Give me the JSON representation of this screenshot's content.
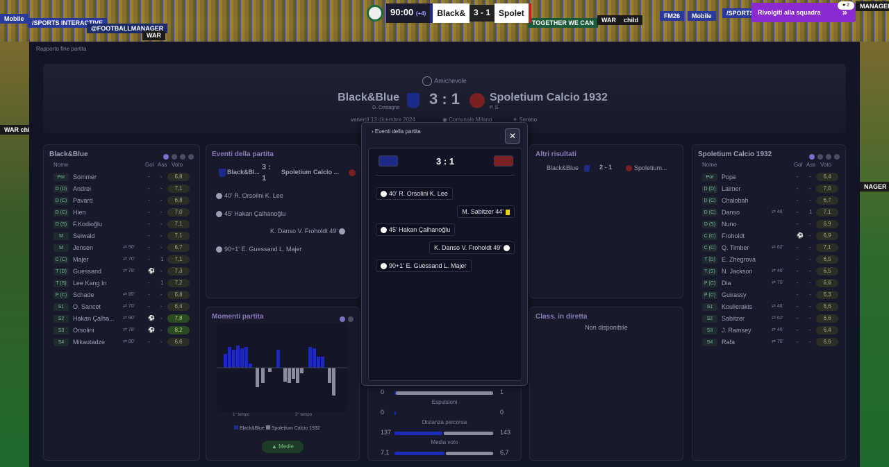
{
  "breadcrumb": "Rapporto fine partita",
  "topbar": {
    "clock": "90:00",
    "added": "(+4)",
    "home": "Black&",
    "score": "3 - 1",
    "away": "Spolet",
    "back_button": "Rivolgiti alla squadra",
    "notif_count": "2"
  },
  "ads": [
    "Mobile",
    "/SPORTS INTERACTIVE",
    "@FOOTBALLMANAGER",
    "WAR",
    "TOGETHER WE CAN",
    "WAR",
    "child",
    "FM26",
    "Mobile",
    "/SPORTS",
    "MANAGER",
    "WAR chi",
    "NAGER"
  ],
  "hero": {
    "competition": "Amichevole",
    "home": "Black&Blue",
    "home_manager": "D. Costagna",
    "score": "3 : 1",
    "away": "Spoletium Calcio 1932",
    "away_manager": "P. S",
    "date": "venerdì 13 dicembre 2024",
    "stadium": "Comunale Milano",
    "weather": "Sereno"
  },
  "home_panel": {
    "title": "Black&Blue",
    "headers": {
      "name": "Nome",
      "gol": "Gol",
      "ass": "Ass",
      "voto": "Voto"
    },
    "rows": [
      {
        "pos": "Por",
        "name": "Sommer",
        "sub": "",
        "gol": "-",
        "ass": "-",
        "voto": "6,8"
      },
      {
        "pos": "D (D)",
        "name": "Andrei",
        "sub": "",
        "gol": "-",
        "ass": "-",
        "voto": "7,1"
      },
      {
        "pos": "D (C)",
        "name": "Pavard",
        "sub": "",
        "gol": "-",
        "ass": "-",
        "voto": "6,8"
      },
      {
        "pos": "D (C)",
        "name": "Hien",
        "sub": "",
        "gol": "-",
        "ass": "-",
        "voto": "7,0"
      },
      {
        "pos": "D (S)",
        "name": "F.Kodioğlu",
        "sub": "",
        "gol": "-",
        "ass": "-",
        "voto": "7,1"
      },
      {
        "pos": "M",
        "name": "Seiwald",
        "sub": "",
        "gol": "-",
        "ass": "-",
        "voto": "7,1"
      },
      {
        "pos": "M",
        "name": "Jensen",
        "sub": "90'",
        "gol": "-",
        "ass": "-",
        "voto": "6,7"
      },
      {
        "pos": "C (C)",
        "name": "Majer",
        "sub": "70'",
        "gol": "-",
        "ass": "1",
        "voto": "7,1"
      },
      {
        "pos": "T (D)",
        "name": "Guessand",
        "sub": "78'",
        "gol": "",
        "ass": "-",
        "voto": "7,3"
      },
      {
        "pos": "T (S)",
        "name": "Lee Kang In",
        "sub": "",
        "gol": "-",
        "ass": "1",
        "voto": "7,2"
      },
      {
        "pos": "P (C)",
        "name": "Schade",
        "sub": "80'",
        "gol": "-",
        "ass": "-",
        "voto": "6,8"
      },
      {
        "pos": "S1",
        "name": "O. Sancet",
        "sub": "70'",
        "gol": "-",
        "ass": "-",
        "voto": "6,4"
      },
      {
        "pos": "S2",
        "name": "Hakan Çalha...",
        "sub": "90'",
        "gol": "",
        "ass": "-",
        "voto": "7,8"
      },
      {
        "pos": "S3",
        "name": "Orsolini",
        "sub": "78'",
        "gol": "",
        "ass": "-",
        "voto": "8,2"
      },
      {
        "pos": "S4",
        "name": "Mikautadze",
        "sub": "80'",
        "gol": "-",
        "ass": "-",
        "voto": "6,6"
      }
    ]
  },
  "away_panel": {
    "title": "Spoletium Calcio 1932",
    "headers": {
      "name": "Nome",
      "gol": "Gol",
      "ass": "Ass",
      "voto": "Voto"
    },
    "rows": [
      {
        "pos": "Por",
        "name": "Pope",
        "sub": "",
        "gol": "-",
        "ass": "-",
        "voto": "6,4"
      },
      {
        "pos": "D (D)",
        "name": "Laimer",
        "sub": "",
        "gol": "-",
        "ass": "-",
        "voto": "7,0"
      },
      {
        "pos": "D (C)",
        "name": "Chalobah",
        "sub": "",
        "gol": "-",
        "ass": "-",
        "voto": "6,7"
      },
      {
        "pos": "D (C)",
        "name": "Danso",
        "sub": "46'",
        "gol": "-",
        "ass": "1",
        "voto": "7,1"
      },
      {
        "pos": "D (S)",
        "name": "Nuno",
        "sub": "",
        "gol": "-",
        "ass": "-",
        "voto": "6,9"
      },
      {
        "pos": "C (C)",
        "name": "Froholdt",
        "sub": "",
        "gol": "",
        "ass": "-",
        "voto": "6,9"
      },
      {
        "pos": "C (C)",
        "name": "Q. Timber",
        "sub": "62'",
        "gol": "-",
        "ass": "-",
        "voto": "7,1"
      },
      {
        "pos": "T (D)",
        "name": "E. Zhegrova",
        "sub": "",
        "gol": "-",
        "ass": "-",
        "voto": "6,5"
      },
      {
        "pos": "T (S)",
        "name": "N. Jackson",
        "sub": "46'",
        "gol": "-",
        "ass": "-",
        "voto": "6,5"
      },
      {
        "pos": "P (C)",
        "name": "Dia",
        "sub": "70'",
        "gol": "-",
        "ass": "-",
        "voto": "6,6"
      },
      {
        "pos": "P (C)",
        "name": "Guirassy",
        "sub": "",
        "gol": "-",
        "ass": "-",
        "voto": "6,3"
      },
      {
        "pos": "S1",
        "name": "Koulierakis",
        "sub": "46'",
        "gol": "-",
        "ass": "-",
        "voto": "6,6"
      },
      {
        "pos": "S2",
        "name": "Sabitzer",
        "sub": "62'",
        "gol": "-",
        "ass": "-",
        "voto": "6,6"
      },
      {
        "pos": "S3",
        "name": "J. Ramsey",
        "sub": "46'",
        "gol": "-",
        "ass": "-",
        "voto": "6,4"
      },
      {
        "pos": "S4",
        "name": "Rafa",
        "sub": "70'",
        "gol": "-",
        "ass": "-",
        "voto": "6,6"
      }
    ]
  },
  "events_panel": {
    "title": "Eventi della partita",
    "home": "Black&Bl...",
    "score_top": "3 :",
    "score_bottom": "1",
    "away": "Spoletium Calcio ...",
    "events": [
      {
        "text": "40' R. Orsolini K. Lee",
        "side": "home"
      },
      {
        "text": "45' Hakan Çalhanoğlu",
        "side": "home"
      },
      {
        "text": "K. Danso V. Froholdt 49'",
        "side": "away"
      },
      {
        "text": "90+1' E. Guessand L. Majer",
        "side": "home"
      }
    ]
  },
  "momenti_panel": {
    "title": "Momenti partita",
    "first_half": "1° tempo",
    "second_half": "2° tempo",
    "legend_home": "Black&Blue",
    "legend_away": "Spoletium Calcio 1932",
    "button": "Medie"
  },
  "stats_panel": {
    "rows": [
      {
        "label": "",
        "home": "0",
        "away": "1"
      },
      {
        "label": "Espulsioni",
        "home": "0",
        "away": "0"
      },
      {
        "label": "Distanza percorsa",
        "home": "137",
        "away": "143"
      },
      {
        "label": "Media voto",
        "home": "7,1",
        "away": "6,7"
      }
    ]
  },
  "other_results": {
    "title": "Altri risultati",
    "home": "Black&Blue",
    "score": "2 - 1",
    "away": "Spoletium..."
  },
  "live_table": {
    "title": "Class. in diretta",
    "empty": "Non disponibile"
  },
  "modal": {
    "title": "Eventi della partita",
    "score": "3 : 1",
    "events": [
      {
        "text": "40' R. Orsolini K. Lee",
        "side": "home",
        "type": "goal"
      },
      {
        "text": "M. Sabitzer 44'",
        "side": "away",
        "type": "yellow"
      },
      {
        "text": "45' Hakan Çalhanoğlu",
        "side": "home",
        "type": "goal"
      },
      {
        "text": "K. Danso V. Froholdt 49'",
        "side": "away",
        "type": "goal"
      },
      {
        "text": "90+1' E. Guessand L. Majer",
        "side": "home",
        "type": "goal"
      }
    ]
  },
  "colors": {
    "accent": "#8a2ad0",
    "home": "#1d2a8a",
    "away": "#7a1f22",
    "panel": "#181a2c"
  }
}
